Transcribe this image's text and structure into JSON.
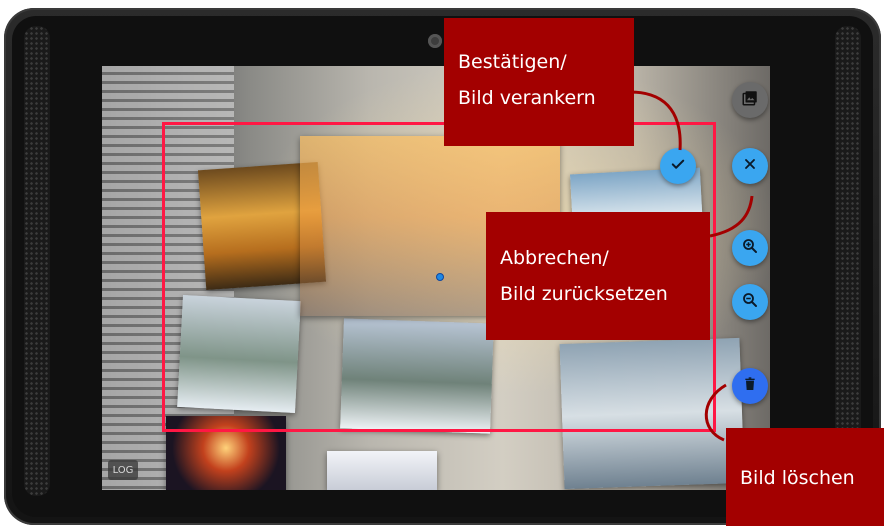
{
  "annotations": {
    "confirm": {
      "line1": "Bestätigen/",
      "line2": "Bild verankern"
    },
    "cancel": {
      "line1": "Abbrechen/",
      "line2": "Bild zurücksetzen"
    },
    "delete": {
      "line1": "Bild löschen"
    }
  },
  "screen": {
    "log_label": "LOG",
    "buttons": {
      "gallery": {
        "icon": "image-gallery-icon"
      },
      "confirm": {
        "icon": "check-icon"
      },
      "cancel": {
        "icon": "close-icon"
      },
      "zoom_in": {
        "icon": "zoom-in-icon"
      },
      "zoom_out": {
        "icon": "zoom-out-icon"
      },
      "delete": {
        "icon": "trash-icon"
      }
    }
  },
  "colors": {
    "selection_frame": "#ff1744",
    "callout_bg": "#a30000",
    "fab_blue": "#3aa6f0",
    "fab_dark_blue": "#2f6ef0"
  }
}
